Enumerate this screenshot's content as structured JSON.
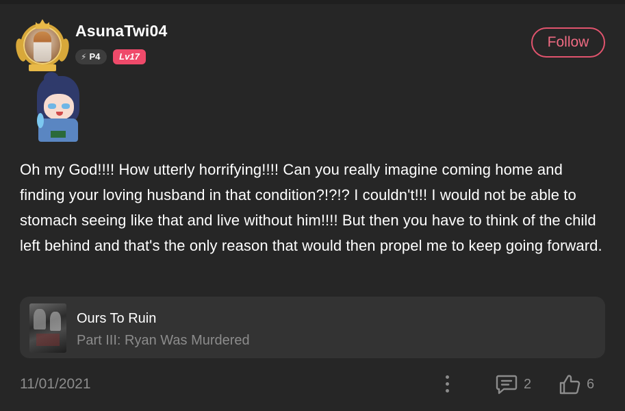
{
  "user": {
    "name": "AsunaTwi04",
    "power_badge": "P4",
    "level_badge": "Lv17",
    "follow_label": "Follow"
  },
  "comment": {
    "text": "Oh my God!!!! How utterly horrifying!!!! Can you really imagine coming home and finding your loving husband in that condition?!?!? I couldn't!!! I would not be able to stomach seeing like that and live without him!!!! But then you have to think of the child left behind and that's the only reason that would then propel me to keep going forward."
  },
  "reference": {
    "title": "Ours To Ruin",
    "subtitle": "Part III: Ryan Was Murdered"
  },
  "footer": {
    "date": "11/01/2021",
    "reply_count": "2",
    "like_count": "6"
  },
  "colors": {
    "background": "#262626",
    "accent": "#e2546e",
    "muted": "#8c8c8c",
    "card": "#333333"
  },
  "icons": [
    "more-vertical-icon",
    "comment-icon",
    "thumbs-up-icon",
    "bolt-icon"
  ]
}
